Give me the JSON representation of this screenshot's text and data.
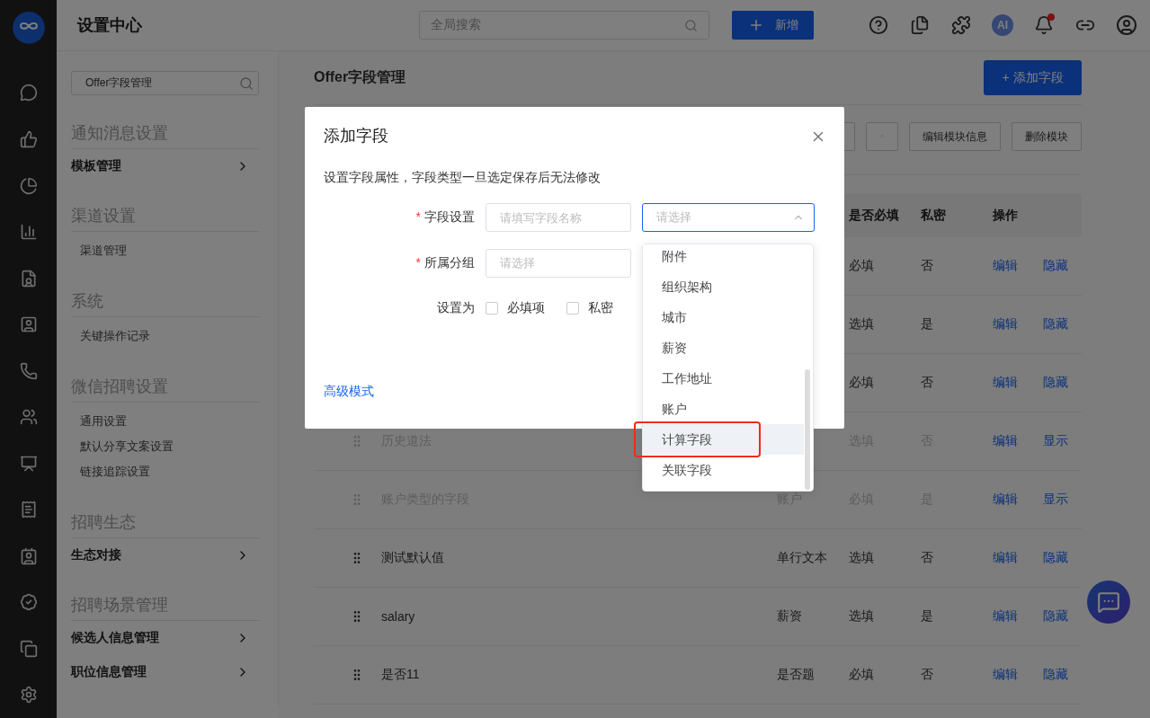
{
  "app": {
    "title": "设置中心"
  },
  "top_bar": {
    "search": {
      "placeholder": "全局搜索"
    },
    "new_button": "新增",
    "ai_label": "AI",
    "has_unread": true
  },
  "sidebar": {
    "search": {
      "value": "Offer字段管理"
    },
    "groups": [
      {
        "title": "通知消息设置",
        "items": [
          {
            "label": "模板管理",
            "kind": "nav"
          }
        ]
      },
      {
        "title": "渠道设置",
        "items": [
          {
            "label": "渠道管理",
            "kind": "link"
          }
        ]
      },
      {
        "title": "系统",
        "items": [
          {
            "label": "关键操作记录",
            "kind": "link"
          }
        ]
      },
      {
        "title": "微信招聘设置",
        "items": [
          {
            "label": "通用设置",
            "kind": "link"
          },
          {
            "label": "默认分享文案设置",
            "kind": "link"
          },
          {
            "label": "链接追踪设置",
            "kind": "link"
          }
        ]
      },
      {
        "title": "招聘生态",
        "items": [
          {
            "label": "生态对接",
            "kind": "nav"
          }
        ]
      },
      {
        "title": "招聘场景管理",
        "items": [
          {
            "label": "候选人信息管理",
            "kind": "nav"
          },
          {
            "label": "职位信息管理",
            "kind": "nav"
          }
        ]
      }
    ]
  },
  "page": {
    "title": "Offer字段管理",
    "add_button": "+ 添加字段",
    "toolbar": [
      "编辑模块信息",
      "删除模块"
    ],
    "table": {
      "columns": {
        "required": "是否必填",
        "private": "私密",
        "actions": "操作"
      },
      "rows": [
        {
          "required": "必填",
          "private": "否",
          "actions": [
            "编辑",
            "隐藏"
          ],
          "disabled": false
        },
        {
          "required": "选填",
          "private": "是",
          "actions": [
            "编辑",
            "隐藏"
          ],
          "disabled": false
        },
        {
          "required": "必填",
          "private": "否",
          "actions": [
            "编辑",
            "隐藏"
          ],
          "disabled": false
        },
        {
          "name": "历史道法",
          "required": "选填",
          "private": "否",
          "actions": [
            "编辑",
            "显示"
          ],
          "disabled": true
        },
        {
          "name": "账户类型的字段",
          "type": "账户",
          "required": "必填",
          "private": "是",
          "actions": [
            "编辑",
            "显示"
          ],
          "disabled": true
        },
        {
          "name": "测试默认值",
          "type": "单行文本",
          "required": "选填",
          "private": "否",
          "actions": [
            "编辑",
            "隐藏"
          ],
          "disabled": false
        },
        {
          "name": "salary",
          "type": "薪资",
          "required": "选填",
          "private": "是",
          "actions": [
            "编辑",
            "隐藏"
          ],
          "disabled": false
        },
        {
          "name": "是否11",
          "type": "是否题",
          "required": "必填",
          "private": "否",
          "actions": [
            "编辑",
            "隐藏"
          ],
          "disabled": false
        }
      ]
    }
  },
  "modal": {
    "title": "添加字段",
    "description": "设置字段属性，字段类型一旦选定保存后无法修改",
    "link": "高级模式",
    "required_mark": "*",
    "form": [
      {
        "kind": "inputs",
        "label": "字段设置",
        "required": true,
        "name_placeholder": "请填写字段名称",
        "type_select": {
          "placeholder": "请选择",
          "open": true
        }
      },
      {
        "kind": "select",
        "label": "所属分组",
        "required": true,
        "placeholder": "请选择"
      },
      {
        "kind": "checkboxes",
        "label": "设置为",
        "options": [
          {
            "label": "必填项",
            "checked": false
          },
          {
            "label": "私密",
            "checked": false
          }
        ]
      }
    ]
  },
  "dropdown": {
    "options": [
      {
        "label": "附件",
        "highlighted": false,
        "annotated": false
      },
      {
        "label": "组织架构",
        "highlighted": false,
        "annotated": false
      },
      {
        "label": "城市",
        "highlighted": false,
        "annotated": false
      },
      {
        "label": "薪资",
        "highlighted": false,
        "annotated": false
      },
      {
        "label": "工作地址",
        "highlighted": false,
        "annotated": false
      },
      {
        "label": "账户",
        "highlighted": false,
        "annotated": false
      },
      {
        "label": "计算字段",
        "highlighted": true,
        "annotated": true
      },
      {
        "label": "关联字段",
        "highlighted": false,
        "annotated": false
      }
    ]
  }
}
